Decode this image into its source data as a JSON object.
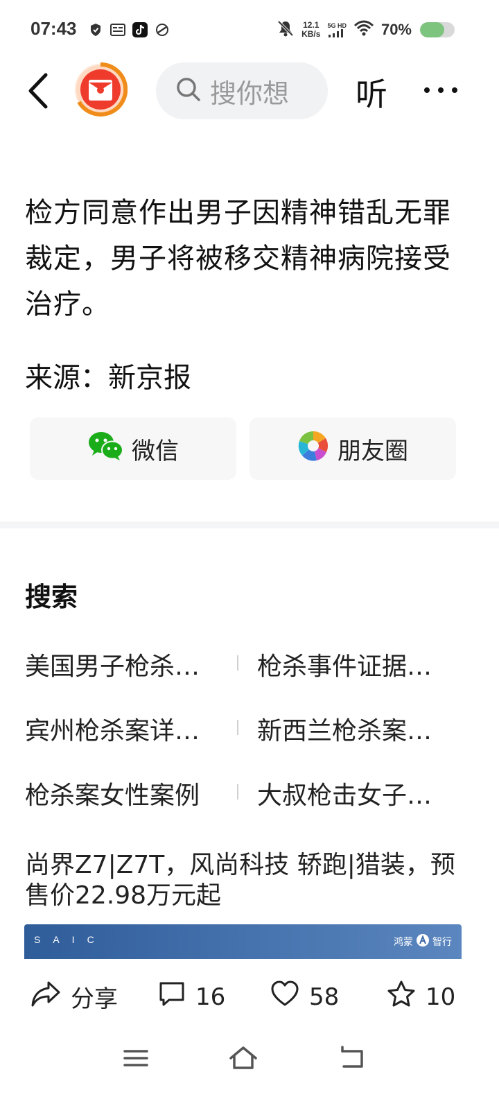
{
  "status_bar": {
    "time": "07:43",
    "net_speed_value": "12.1",
    "net_speed_unit": "KB/s",
    "network_label": "5G HD",
    "battery_text": "70%",
    "battery_level": 0.7,
    "left_icons": [
      "shield-icon",
      "toutiao-icon",
      "tiktok-icon",
      "link-icon"
    ],
    "right_icons": [
      "mute-bell-icon",
      "signal-icon",
      "wifi-icon",
      "battery-icon"
    ]
  },
  "topbar": {
    "search_placeholder": "搜你想",
    "listen_label": "听",
    "icons": [
      "back-icon",
      "red-packet-icon",
      "search-icon",
      "more-icon"
    ]
  },
  "article": {
    "body": "检方同意作出男子因精神错乱无罪裁定，男子将被移交精神病院接受治疗。",
    "source": "来源：新京报"
  },
  "share": {
    "wechat_label": "微信",
    "moments_label": "朋友圈"
  },
  "search_section": {
    "title": "搜索",
    "suggestions": [
      "美国男子枪杀…",
      "枪杀事件证据…",
      "宾州枪杀案详…",
      "新西兰枪杀案…",
      "枪杀案女性案例",
      "大叔枪击女子…"
    ]
  },
  "ad": {
    "text": "尚界Z7|Z7T，风尚科技 轿跑|猎装，预售价22.98万元起",
    "banner_brand": "SAIC",
    "banner_partner_left": "鸿蒙",
    "banner_partner_right": "智行"
  },
  "actions": {
    "share_label": "分享",
    "comment_count": "16",
    "like_count": "58",
    "favorite_count": "10"
  },
  "navbar": {
    "icons": [
      "menu-icon",
      "home-icon",
      "back-nav-icon"
    ]
  }
}
